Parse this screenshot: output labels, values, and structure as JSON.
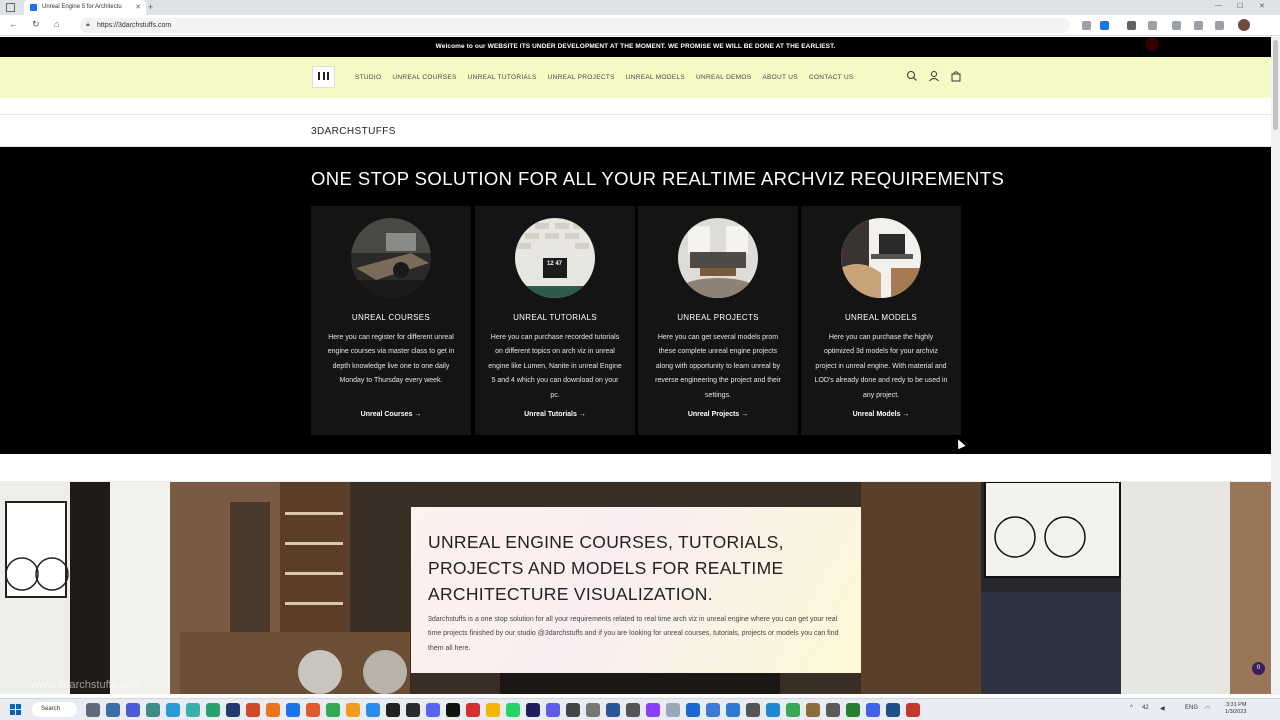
{
  "browser": {
    "tab_title": "Unreal Engine 5 for Architectu",
    "url": "https://3darchstuffs.com"
  },
  "announcement": "Welcome to our WEBSITE ITS UNDER DEVELOPMENT AT THE MOMENT. WE PROMISE WE WILL BE DONE AT THE EARLIEST.",
  "nav": {
    "items": [
      "STUDIO",
      "UNREAL COURSES",
      "UNREAL TUTORIALS",
      "UNREAL PROJECTS",
      "UNREAL MODELS",
      "UNREAL DEMOS",
      "ABOUT US",
      "CONTACT US"
    ]
  },
  "site_title": "3DARCHSTUFFS",
  "hero": {
    "heading": "ONE STOP SOLUTION FOR ALL YOUR REALTIME ARCHVIZ REQUIREMENTS",
    "cards": [
      {
        "title": "UNREAL COURSES",
        "text": "Here you can register for different unreal engine courses via master class to get in depth knowledge live one to one daily Monday to Thursday every week.",
        "link": "Unreal Courses"
      },
      {
        "title": "UNREAL TUTORIALS",
        "text": "Here you can purchase recorded tutorials on different topics on arch viz in unreal engine like Lumen, Nanite in unreal Engine 5 and 4 which you can download on your pc.",
        "link": "Unreal Tutorials"
      },
      {
        "title": "UNREAL PROJECTS",
        "text": "Here you can get several models prom these complete unreal engine projects along with opportunity to learn unreal by reverse engineering the project and their settings.",
        "link": "Unreal Projects"
      },
      {
        "title": "UNREAL MODELS",
        "text": "Here you can purchase the highly optimized 3d models for your archviz project in unreal engine. With material and LOD's already done and redy to be used in any project.",
        "link": "Unreal Models"
      }
    ],
    "thumb_clock_text": "12 47"
  },
  "banner": {
    "heading": "UNREAL ENGINE COURSES, TUTORIALS, PROJECTS AND MODELS FOR REALTIME ARCHITECTURE VISUALIZATION.",
    "text": "3darchstuffs is a one stop solution for all your requirements related to real time arch viz in unreal engine where you can get your real time projects finished by our studio @3darchstuffs and if you are looking for unreal courses, tutorials, projects or models you can find them all here.",
    "watermark": "www.3darchstuffs.com",
    "chat_badge": "0"
  },
  "taskbar": {
    "search_label": "Search",
    "tray_lang": "ENG",
    "time": "3:31 PM",
    "date": "1/3/2023",
    "temp": "42"
  },
  "colors": {
    "header_bg": "#f6fbc6",
    "hero_bg": "#000000",
    "card_bg": "#141414",
    "announce_bg": "#000000"
  },
  "icons": {
    "header": [
      "search-icon",
      "account-icon",
      "cart-icon"
    ],
    "link_arrow": "→"
  }
}
